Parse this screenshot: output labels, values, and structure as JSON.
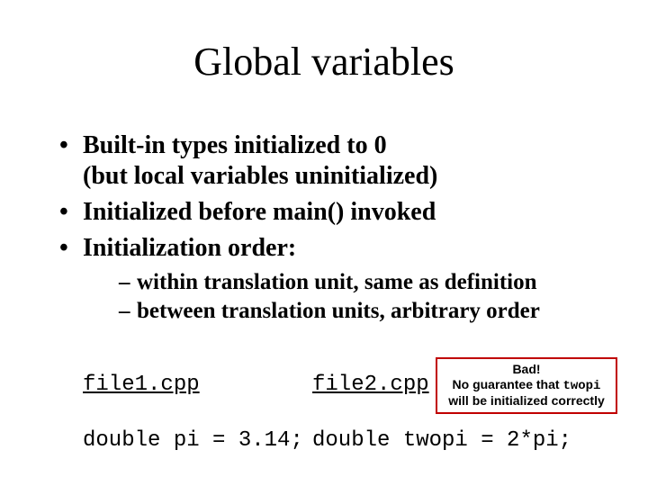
{
  "title": "Global variables",
  "bullets": {
    "b1_line1": "Built-in types initialized to 0",
    "b1_line2": "(but local variables uninitialized)",
    "b2": "Initialized before main() invoked",
    "b3": "Initialization order:",
    "sub1": "within translation unit, same as definition",
    "sub2": "between translation units, arbitrary order"
  },
  "files": {
    "f1": "file1.cpp",
    "f2": "file2.cpp"
  },
  "defs": {
    "d1": "double pi = 3.14;",
    "d2": "double twopi = 2*pi;"
  },
  "note": {
    "line1": "Bad!",
    "line2a": "No guarantee that ",
    "line2b": "twopi",
    "line3": "will be initialized correctly"
  }
}
